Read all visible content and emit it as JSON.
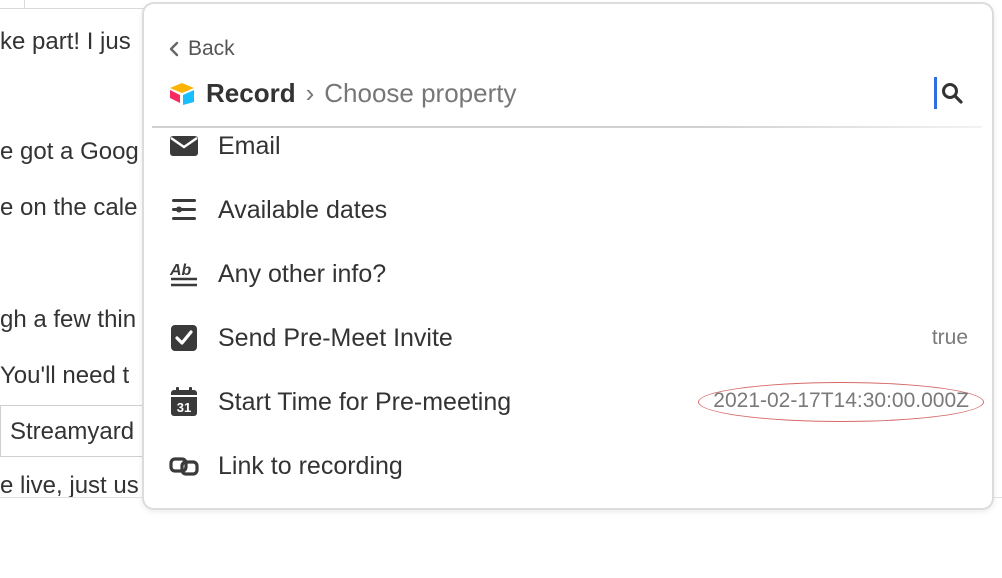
{
  "background": {
    "lines": [
      "ke part! I jus",
      "e got a Goog",
      "e on the cale",
      "gh a few thin",
      "You'll need t",
      "Streamyard",
      "e live, just us"
    ]
  },
  "panel": {
    "back_label": "Back",
    "breadcrumb": {
      "record": "Record",
      "separator": "›",
      "choose": "Choose property"
    },
    "items": [
      {
        "label": "Email",
        "icon": "envelope-icon",
        "value": ""
      },
      {
        "label": "Available dates",
        "icon": "multiselect-icon",
        "value": ""
      },
      {
        "label": "Any other info?",
        "icon": "long-text-icon",
        "value": ""
      },
      {
        "label": "Send Pre-Meet Invite",
        "icon": "checkbox-icon",
        "value": "true"
      },
      {
        "label": "Start Time for Pre-meeting",
        "icon": "calendar-icon",
        "calendar_day": "31",
        "value": "2021-02-17T14:30:00.000Z"
      },
      {
        "label": "Link to recording",
        "icon": "link-icon",
        "value": ""
      }
    ],
    "accent_color": "#2f6fdd",
    "annotation_color": "#d66a6a"
  }
}
